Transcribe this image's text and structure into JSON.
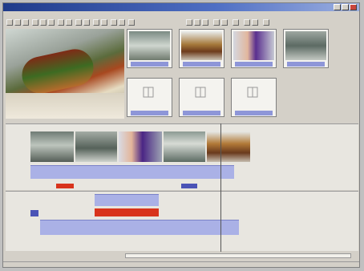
{
  "colors": {
    "accent": "#8e96d8",
    "track_bar": "#aab1e6",
    "marker_red": "#d8331c",
    "marker_blue": "#4a53b6",
    "title_bar": "#1e3a8a"
  },
  "titlebar": {
    "title": ""
  },
  "menubar": {
    "items": [
      "",
      "",
      "",
      "",
      "",
      ""
    ]
  },
  "bins": [
    {
      "thumb": "factory-floor"
    },
    {
      "thumb": "vehicle-closeup"
    },
    {
      "thumb": "worker-purple"
    },
    {
      "thumb": "assembly-line"
    },
    {
      "thumb": "empty"
    },
    {
      "thumb": "empty"
    },
    {
      "thumb": "empty"
    }
  ],
  "timeline": {
    "clips": [
      "factory-floor",
      "assembly-line",
      "worker-purple",
      "factory-interior",
      "vehicle-closeup"
    ]
  },
  "bottombar": {
    "labels": []
  },
  "statusbar": {
    "text": []
  }
}
